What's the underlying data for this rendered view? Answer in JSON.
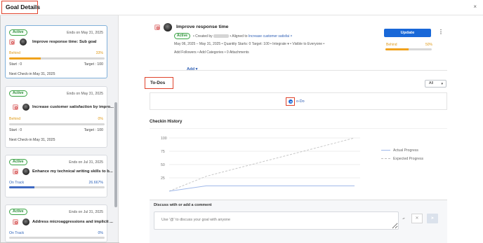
{
  "dialog": {
    "title": "Goal Details",
    "close_label": "×"
  },
  "goal_list": [
    {
      "status_pill": "Active",
      "ends": "Ends on May 31, 2025",
      "title": "Improve response time: Sub goal",
      "progress_label": "Behind",
      "progress_percent": "33%",
      "progress_fraction": 0.33,
      "start": "Start : 0",
      "target": "Target : 100",
      "next_checkin": "Next Check-in May 31, 2025"
    },
    {
      "status_pill": "Active",
      "ends": "Ends on May 31, 2025",
      "title": "Increase customer satisfaction by impro...",
      "progress_label": "Behind",
      "progress_percent": "0%",
      "progress_fraction": 0.0,
      "start": "Start : 0",
      "target": "Target : 100",
      "next_checkin": "Next Check-in May 31, 2025"
    },
    {
      "status_pill": "Active",
      "ends": "Ends on Jul 31, 2025",
      "title": "Enhance my technical writing skills to b...",
      "progress_label": "On Track",
      "progress_percent": "26.667%",
      "progress_fraction": 0.26667
    },
    {
      "status_pill": "Active",
      "ends": "Ends on Jul 31, 2025",
      "title": "Address microaggressions and implicit ...",
      "progress_label": "On Track",
      "progress_percent": "0%",
      "progress_fraction": 0.0
    }
  ],
  "selected_goal": {
    "title": "Improve response time",
    "status_pill": "Active",
    "created_by": "• Created by",
    "aligned_to_prefix": "• Aligned to",
    "aligned_to_link": "Increase customer satisfai",
    "aligned_to_close": "×",
    "meta_line": "May 06, 2025 – May 31, 2025   • Quantity   Starts: 0   Target: 100   • Integrate ▾   • Visible to Everyone   •",
    "meta_line_2": "Add Followers   • Add Categories   • 0 Attachments",
    "update_button": "Update",
    "menu_label": "⋮",
    "progress_label": "Behind",
    "progress_percent": "50%",
    "progress_fraction": 0.5,
    "add_label": "Add"
  },
  "todos": {
    "title": "To-Dos",
    "filter": "All",
    "add_todo_label": "o-Do"
  },
  "checkin_history": {
    "title": "Checkin History",
    "legend": [
      "Actual Progress",
      "Expected Progress"
    ]
  },
  "chart_data": {
    "type": "line",
    "title": "Checkin History",
    "y_tick_labels": [
      "100",
      "75",
      "50",
      "25"
    ],
    "ylim": [
      0,
      100
    ],
    "series": [
      {
        "name": "Actual Progress",
        "values": [
          0,
          10,
          10,
          10,
          10,
          10
        ]
      },
      {
        "name": "Expected Progress",
        "values": [
          0,
          28,
          46,
          64,
          82,
          100
        ]
      }
    ]
  },
  "discussion": {
    "title": "Discuss with or add a comment",
    "placeholder": "Use '@' to discuss your goal with anyone"
  },
  "icons": {
    "close": "close-icon",
    "goal": "goal-icon",
    "avatar": "user-avatar",
    "quantity": "quantity-icon",
    "chevron": "chevron-down-icon",
    "add_todo": "plus-circle-icon",
    "attach": "paperclip-icon",
    "clear": "close-icon",
    "send": "send-icon"
  },
  "colors": {
    "brand_blue": "#1968d8",
    "active_green": "#3ca247",
    "behind_orange": "#f0a21c",
    "on_track_blue": "#3f6ac2",
    "highlight_red": "#e0432c"
  }
}
